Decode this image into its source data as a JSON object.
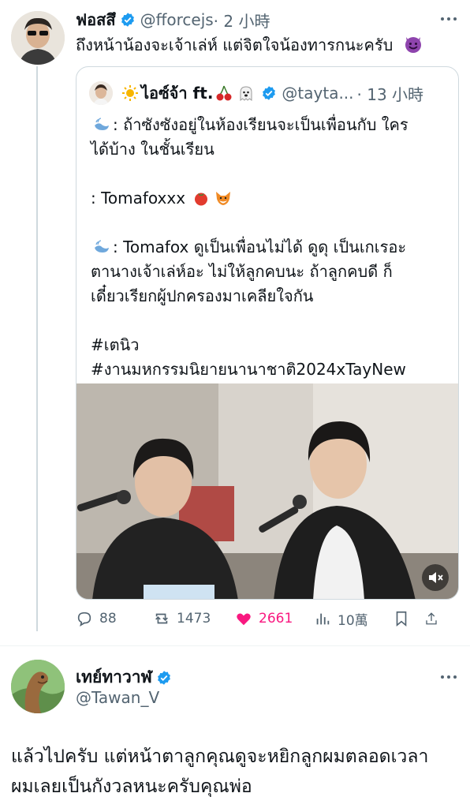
{
  "tweet1": {
    "name": "ฟอสสึ",
    "handle": "@fforcejs",
    "time": "· 2 小時",
    "text": "ถึงหน้าน้องจะเจ้าเล่ห์ แต่จิตใจน้องทารกนะครับ"
  },
  "quote": {
    "name_prefix": "ไอซ์จ้า ft.",
    "handle": "@tayta...",
    "time": "· 13 小時",
    "line1": ": ถ้าซังซังอยู่ในห้องเรียนจะเป็นเพื่อนกับ ใคร",
    "line2": "ได้บ้าง ในชั้นเรียน",
    "line3": ": Tomafoxxx",
    "line4": ": Tomafox ดูเป็นเพื่อนไม่ได้ ดูดุ เป็นเกเรอะ",
    "line5": "ตานางเจ้าเล่ห์อะ ไม่ให้ลูกคบนะ ถ้าลูกคบดี ก็",
    "line6": "เดี๋ยวเรียกผู้ปกครองมาเคลียใจกัน",
    "hashtag1": "#เตนิว",
    "hashtag2": "#งานมหกรรมนิยายนานาชาติ2024xTayNew"
  },
  "actions": {
    "replies": "88",
    "retweets": "1473",
    "likes": "2661",
    "views": "10萬"
  },
  "tweet2": {
    "name": "เทย์ทาวาฬ",
    "handle": "@Tawan_V",
    "line1": "แล้วไปครับ แต่หน้าตาลูกคุณดูจะหยิกลูกผมตลอดเวลา",
    "line2": "ผมเลยเป็นกังวลหนะครับคุณพ่อ"
  },
  "colors": {
    "verified": "#1d9bf0",
    "like": "#f91880",
    "secondary_text": "#536471"
  }
}
